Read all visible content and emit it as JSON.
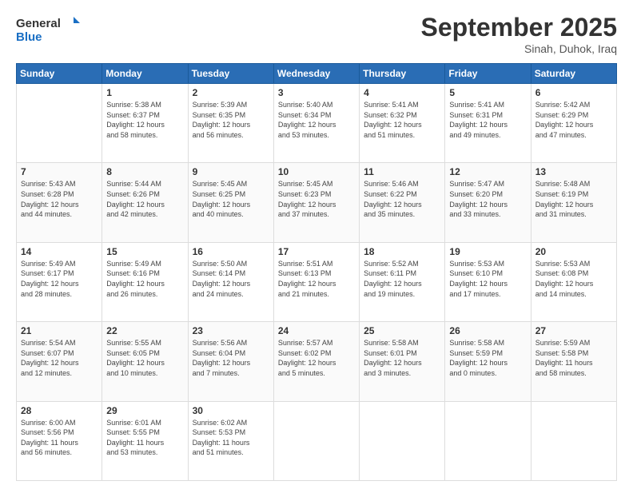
{
  "header": {
    "logo_line1": "General",
    "logo_line2": "Blue",
    "month": "September 2025",
    "location": "Sinah, Duhok, Iraq"
  },
  "days_of_week": [
    "Sunday",
    "Monday",
    "Tuesday",
    "Wednesday",
    "Thursday",
    "Friday",
    "Saturday"
  ],
  "weeks": [
    [
      {
        "day": "",
        "info": ""
      },
      {
        "day": "1",
        "info": "Sunrise: 5:38 AM\nSunset: 6:37 PM\nDaylight: 12 hours\nand 58 minutes."
      },
      {
        "day": "2",
        "info": "Sunrise: 5:39 AM\nSunset: 6:35 PM\nDaylight: 12 hours\nand 56 minutes."
      },
      {
        "day": "3",
        "info": "Sunrise: 5:40 AM\nSunset: 6:34 PM\nDaylight: 12 hours\nand 53 minutes."
      },
      {
        "day": "4",
        "info": "Sunrise: 5:41 AM\nSunset: 6:32 PM\nDaylight: 12 hours\nand 51 minutes."
      },
      {
        "day": "5",
        "info": "Sunrise: 5:41 AM\nSunset: 6:31 PM\nDaylight: 12 hours\nand 49 minutes."
      },
      {
        "day": "6",
        "info": "Sunrise: 5:42 AM\nSunset: 6:29 PM\nDaylight: 12 hours\nand 47 minutes."
      }
    ],
    [
      {
        "day": "7",
        "info": "Sunrise: 5:43 AM\nSunset: 6:28 PM\nDaylight: 12 hours\nand 44 minutes."
      },
      {
        "day": "8",
        "info": "Sunrise: 5:44 AM\nSunset: 6:26 PM\nDaylight: 12 hours\nand 42 minutes."
      },
      {
        "day": "9",
        "info": "Sunrise: 5:45 AM\nSunset: 6:25 PM\nDaylight: 12 hours\nand 40 minutes."
      },
      {
        "day": "10",
        "info": "Sunrise: 5:45 AM\nSunset: 6:23 PM\nDaylight: 12 hours\nand 37 minutes."
      },
      {
        "day": "11",
        "info": "Sunrise: 5:46 AM\nSunset: 6:22 PM\nDaylight: 12 hours\nand 35 minutes."
      },
      {
        "day": "12",
        "info": "Sunrise: 5:47 AM\nSunset: 6:20 PM\nDaylight: 12 hours\nand 33 minutes."
      },
      {
        "day": "13",
        "info": "Sunrise: 5:48 AM\nSunset: 6:19 PM\nDaylight: 12 hours\nand 31 minutes."
      }
    ],
    [
      {
        "day": "14",
        "info": "Sunrise: 5:49 AM\nSunset: 6:17 PM\nDaylight: 12 hours\nand 28 minutes."
      },
      {
        "day": "15",
        "info": "Sunrise: 5:49 AM\nSunset: 6:16 PM\nDaylight: 12 hours\nand 26 minutes."
      },
      {
        "day": "16",
        "info": "Sunrise: 5:50 AM\nSunset: 6:14 PM\nDaylight: 12 hours\nand 24 minutes."
      },
      {
        "day": "17",
        "info": "Sunrise: 5:51 AM\nSunset: 6:13 PM\nDaylight: 12 hours\nand 21 minutes."
      },
      {
        "day": "18",
        "info": "Sunrise: 5:52 AM\nSunset: 6:11 PM\nDaylight: 12 hours\nand 19 minutes."
      },
      {
        "day": "19",
        "info": "Sunrise: 5:53 AM\nSunset: 6:10 PM\nDaylight: 12 hours\nand 17 minutes."
      },
      {
        "day": "20",
        "info": "Sunrise: 5:53 AM\nSunset: 6:08 PM\nDaylight: 12 hours\nand 14 minutes."
      }
    ],
    [
      {
        "day": "21",
        "info": "Sunrise: 5:54 AM\nSunset: 6:07 PM\nDaylight: 12 hours\nand 12 minutes."
      },
      {
        "day": "22",
        "info": "Sunrise: 5:55 AM\nSunset: 6:05 PM\nDaylight: 12 hours\nand 10 minutes."
      },
      {
        "day": "23",
        "info": "Sunrise: 5:56 AM\nSunset: 6:04 PM\nDaylight: 12 hours\nand 7 minutes."
      },
      {
        "day": "24",
        "info": "Sunrise: 5:57 AM\nSunset: 6:02 PM\nDaylight: 12 hours\nand 5 minutes."
      },
      {
        "day": "25",
        "info": "Sunrise: 5:58 AM\nSunset: 6:01 PM\nDaylight: 12 hours\nand 3 minutes."
      },
      {
        "day": "26",
        "info": "Sunrise: 5:58 AM\nSunset: 5:59 PM\nDaylight: 12 hours\nand 0 minutes."
      },
      {
        "day": "27",
        "info": "Sunrise: 5:59 AM\nSunset: 5:58 PM\nDaylight: 11 hours\nand 58 minutes."
      }
    ],
    [
      {
        "day": "28",
        "info": "Sunrise: 6:00 AM\nSunset: 5:56 PM\nDaylight: 11 hours\nand 56 minutes."
      },
      {
        "day": "29",
        "info": "Sunrise: 6:01 AM\nSunset: 5:55 PM\nDaylight: 11 hours\nand 53 minutes."
      },
      {
        "day": "30",
        "info": "Sunrise: 6:02 AM\nSunset: 5:53 PM\nDaylight: 11 hours\nand 51 minutes."
      },
      {
        "day": "",
        "info": ""
      },
      {
        "day": "",
        "info": ""
      },
      {
        "day": "",
        "info": ""
      },
      {
        "day": "",
        "info": ""
      }
    ]
  ]
}
